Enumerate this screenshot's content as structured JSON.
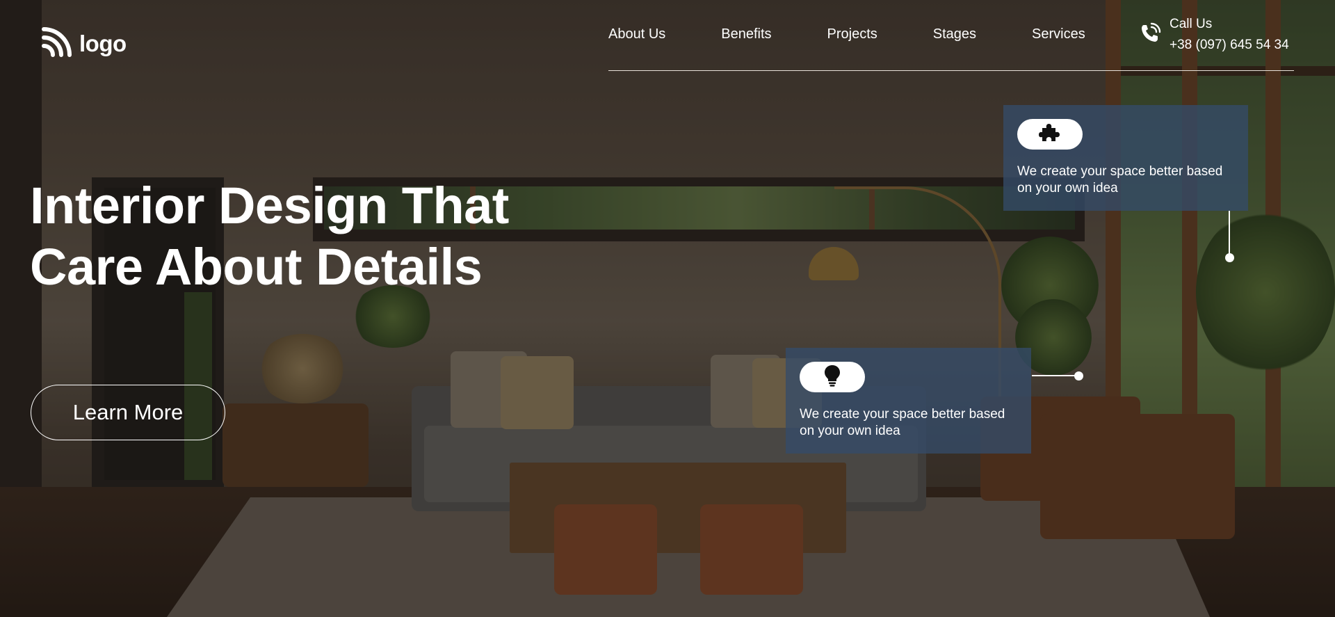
{
  "brand": {
    "name": "logo"
  },
  "nav": {
    "items": [
      "About Us",
      "Benefits",
      "Projects",
      "Stages",
      "Services"
    ]
  },
  "contact": {
    "label": "Call Us",
    "phone": "+38 (097) 645 54 34"
  },
  "hero": {
    "title_line1": "Interior Design That",
    "title_line2": "Care About Details",
    "cta_label": "Learn More"
  },
  "cards": [
    {
      "icon": "puzzle-icon",
      "text": "We create your space better based on your own idea"
    },
    {
      "icon": "lightbulb-icon",
      "text": "We create your space better based on your own idea"
    }
  ],
  "colors": {
    "card_bg": "#344b69",
    "accent": "#ffffff"
  }
}
